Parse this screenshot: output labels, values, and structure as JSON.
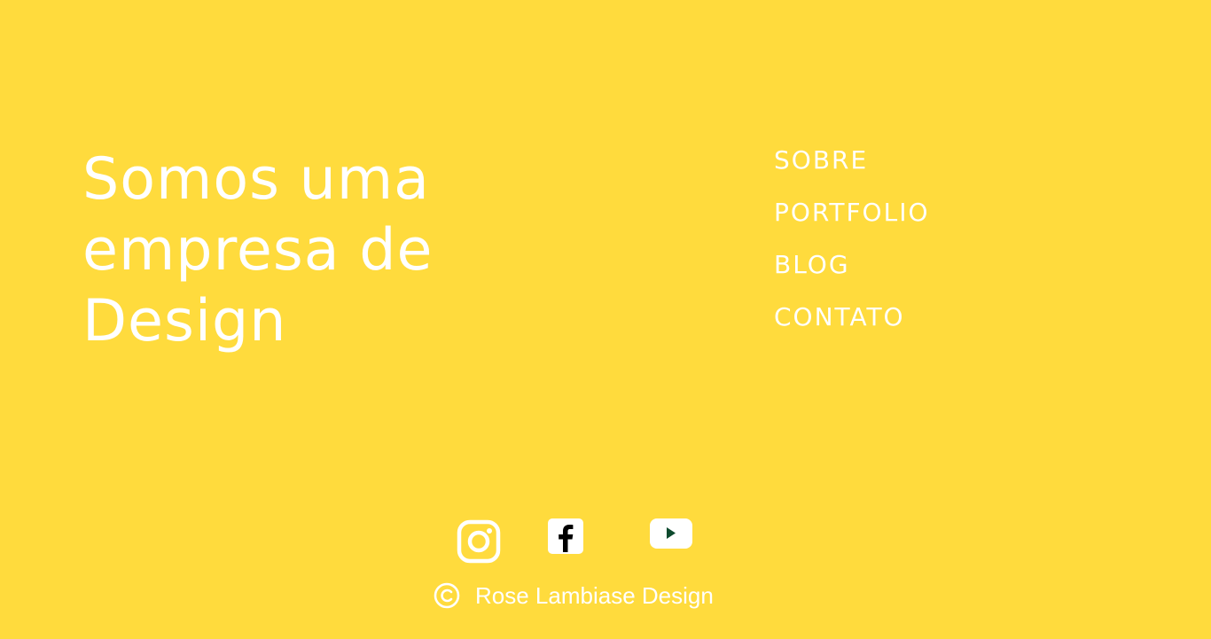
{
  "hero": {
    "headline_lines": [
      "Somos uma",
      "empresa de",
      "Design"
    ]
  },
  "nav": {
    "items": [
      {
        "label": "SOBRE"
      },
      {
        "label": "PORTFOLIO"
      },
      {
        "label": "BLOG"
      },
      {
        "label": "CONTATO"
      }
    ]
  },
  "social": {
    "icons": [
      "instagram-icon",
      "facebook-icon",
      "youtube-icon"
    ]
  },
  "footer": {
    "copyright_icon": "copyright-icon",
    "text": "Rose Lambiase Design"
  },
  "colors": {
    "background": "#FFDB3D",
    "text": "#FFFFFF",
    "icon_dark": "#000000",
    "youtube_play": "#0E4A2E"
  }
}
